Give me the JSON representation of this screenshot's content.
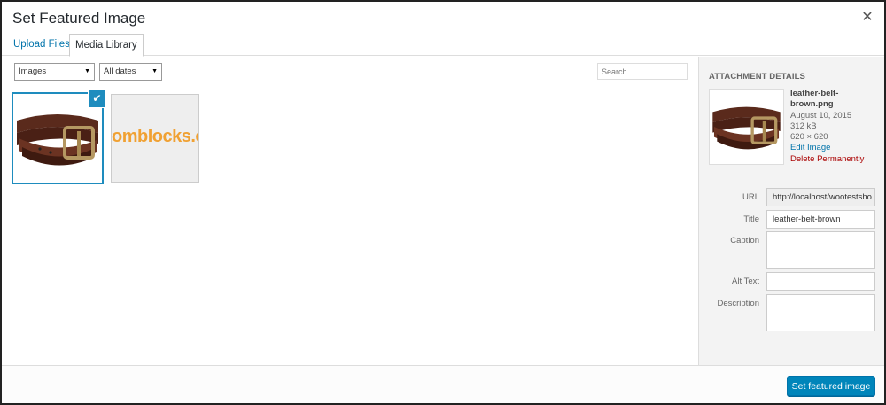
{
  "modal": {
    "title": "Set Featured Image",
    "close_glyph": "✕"
  },
  "tabs": [
    {
      "label": "Upload Files",
      "active": false
    },
    {
      "label": "Media Library",
      "active": true
    }
  ],
  "filters": {
    "type": "Images",
    "dates": "All dates",
    "search_placeholder": "Search"
  },
  "attachments": [
    {
      "name": "leather-belt-brown",
      "selected": true,
      "icon": "check-icon"
    },
    {
      "name": "logo",
      "text": "omblocks.co",
      "selected": false
    }
  ],
  "details": {
    "heading": "Attachment Details",
    "filename": "leather-belt-brown.png",
    "date": "August 10, 2015",
    "size": "312 kB",
    "dimensions": "620 × 620",
    "edit_link": "Edit Image",
    "delete_link": "Delete Permanently"
  },
  "fields": {
    "url_label": "URL",
    "url_value": "http://localhost/wootestsho",
    "title_label": "Title",
    "title_value": "leather-belt-brown",
    "caption_label": "Caption",
    "caption_value": "",
    "alt_label": "Alt Text",
    "alt_value": "",
    "description_label": "Description",
    "description_value": ""
  },
  "footer": {
    "button_label": "Set featured image"
  },
  "colors": {
    "accent": "#0085ba",
    "link": "#0073aa",
    "danger": "#aa0000",
    "selected_border": "#1e8cbe"
  }
}
